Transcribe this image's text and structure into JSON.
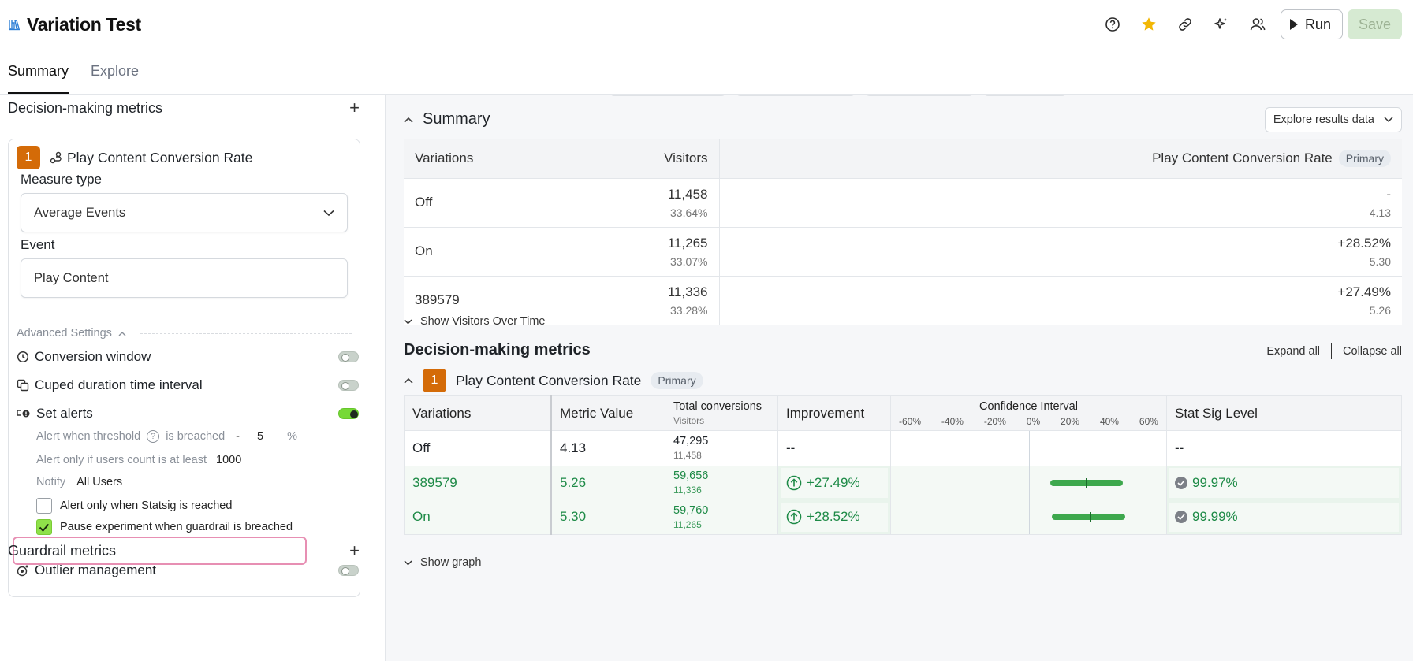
{
  "header": {
    "title": "Variation Test",
    "tabs": [
      "Summary",
      "Explore"
    ],
    "run_label": "Run",
    "save_label": "Save"
  },
  "left": {
    "decision_title": "Decision-making metrics",
    "metric_number": "1",
    "metric_name": "Play Content Conversion Rate",
    "measure_type_label": "Measure type",
    "measure_type_value": "Average Events",
    "event_label": "Event",
    "event_value": "Play Content",
    "advanced_label": "Advanced Settings",
    "conversion_window": "Conversion window",
    "cuped": "Cuped duration time interval",
    "set_alerts": "Set alerts",
    "alert_threshold_label": "Alert when threshold",
    "alert_breached": "is breached",
    "alert_sign": "-",
    "alert_value": "5",
    "alert_unit": "%",
    "alert_users_label": "Alert only if users count is at least",
    "alert_users_value": "1000",
    "notify_label": "Notify",
    "notify_value": "All Users",
    "check_statsig": "Alert only when Statsig is reached",
    "check_pause": "Pause experiment when guardrail is breached",
    "outlier": "Outlier management",
    "guardrail_title": "Guardrail metrics"
  },
  "summary": {
    "title": "Summary",
    "explore_dd": "Explore results data",
    "headers": [
      "Variations",
      "Visitors",
      "Play Content Conversion Rate"
    ],
    "primary_label": "Primary",
    "rows": [
      {
        "name": "Off",
        "visitors": "11,458",
        "pct": "33.64%",
        "rate": "-",
        "rate_sub": "4.13"
      },
      {
        "name": "On",
        "visitors": "11,265",
        "pct": "33.07%",
        "rate": "+28.52%",
        "rate_sub": "5.30"
      },
      {
        "name": "389579",
        "visitors": "11,336",
        "pct": "33.28%",
        "rate": "+27.49%",
        "rate_sub": "5.26"
      }
    ],
    "show_visitors": "Show Visitors Over Time"
  },
  "dm": {
    "title": "Decision-making metrics",
    "expand_all": "Expand all",
    "collapse_all": "Collapse all",
    "metric_number": "1",
    "metric_name": "Play Content Conversion Rate",
    "primary_label": "Primary",
    "headers": {
      "variations": "Variations",
      "metric_value": "Metric Value",
      "total_conv": "Total conversions",
      "visitors": "Visitors",
      "improvement": "Improvement",
      "ci": "Confidence Interval",
      "stat": "Stat Sig Level"
    },
    "ticks": [
      "-60%",
      "-40%",
      "-20%",
      "0%",
      "20%",
      "40%",
      "60%"
    ],
    "rows": [
      {
        "name": "Off",
        "metric": "4.13",
        "conv": "47,295",
        "visitors": "11,458",
        "improvement": "--",
        "stat": "--"
      },
      {
        "name": "389579",
        "metric": "5.26",
        "conv": "59,656",
        "visitors": "11,336",
        "improvement": "+27.49%",
        "stat": "99.97%",
        "ci_low": 11,
        "ci_high": 48,
        "ci_mid": 29
      },
      {
        "name": "On",
        "metric": "5.30",
        "conv": "59,760",
        "visitors": "11,265",
        "improvement": "+28.52%",
        "stat": "99.99%",
        "ci_low": 12,
        "ci_high": 49,
        "ci_mid": 31
      }
    ],
    "show_graph": "Show graph"
  }
}
